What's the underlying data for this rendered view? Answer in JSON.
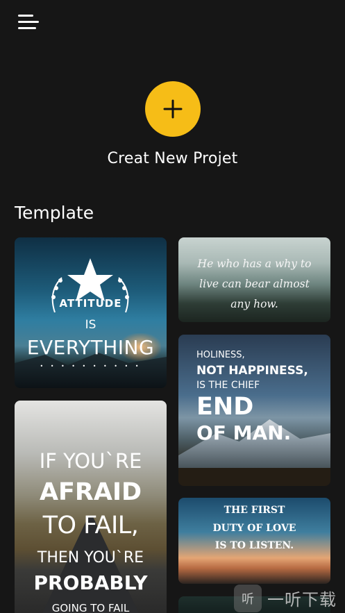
{
  "header": {
    "menu_icon": "hamburger-menu-icon"
  },
  "create": {
    "icon": "plus-icon",
    "label": "Creat New Projet",
    "color": "#f6bd17"
  },
  "templates": {
    "title": "Template",
    "cards": [
      {
        "lines": [
          "ATTITUDE",
          "IS",
          "EVERYTHING",
          "• • • • • • • • • •"
        ]
      },
      {
        "lines": [
          "He who has a why to live can bear almost any how."
        ]
      },
      {
        "lines": [
          "HOLINESS,",
          "NOT HAPPINESS,",
          "IS THE CHIEF",
          "END",
          "OF MAN."
        ]
      },
      {
        "lines": [
          "IF YOU`RE",
          "AFRAID",
          "TO FAIL,",
          "THEN YOU`RE",
          "PROBABLY",
          "GOING TO FAIL"
        ]
      },
      {
        "lines": [
          "THE FIRST",
          "DUTY OF LOVE",
          "IS TO LISTEN."
        ]
      }
    ]
  },
  "watermark": {
    "logo": "听",
    "text": "一听下载"
  }
}
